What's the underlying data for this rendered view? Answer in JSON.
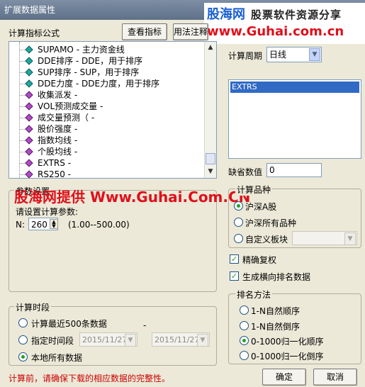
{
  "window": {
    "title": "扩展数据属性"
  },
  "brand": {
    "name": "股海网",
    "slogan": "股票软件资源分享",
    "url": "www.Guhai.com.cn"
  },
  "formula": {
    "label": "计算指标公式",
    "view_button": "查看指标",
    "usage_button": "用法注释",
    "items": [
      {
        "text": "SUPAMO - 主力资金线",
        "color": "teal"
      },
      {
        "text": "DDE排序 - DDE，用于排序",
        "color": "teal"
      },
      {
        "text": "SUP排序 - SUP，用于排序",
        "color": "teal"
      },
      {
        "text": "DDE力度 - DDE力度，用于排序",
        "color": "teal"
      },
      {
        "text": "收集派发 -",
        "color": "purple"
      },
      {
        "text": "VOL预测成交量 -",
        "color": "purple"
      },
      {
        "text": "成交量预测（ -",
        "color": "purple"
      },
      {
        "text": "股价强度 -",
        "color": "purple"
      },
      {
        "text": "指数均线 -",
        "color": "purple"
      },
      {
        "text": "个股均线 -",
        "color": "purple"
      },
      {
        "text": "EXTRS -",
        "color": "purple"
      },
      {
        "text": "RS250 -",
        "color": "purple"
      }
    ]
  },
  "params": {
    "group_title": "参数设置",
    "prompt": "请设置计算参数:",
    "n_label": "N:",
    "n_value": "260",
    "n_range": "(1.00--500.00)"
  },
  "watermark": "股海网提供 Www.Guhai.Com.CN",
  "period": {
    "label": "计算周期",
    "value": "日线"
  },
  "result_list": {
    "selected": "EXTRS"
  },
  "default_value": {
    "label": "缺省数值",
    "value": "0"
  },
  "variety": {
    "group_title": "计算品种",
    "options": [
      "沪深A股",
      "沪深所有品种",
      "自定义板块"
    ],
    "selected_index": 0
  },
  "checks": {
    "exact_rights": "精确复权",
    "rank_data": "生成横向排名数据"
  },
  "rank_method": {
    "group_title": "排名方法",
    "options": [
      "1-N自然顺序",
      "1-N自然倒序",
      "0-1000归一化顺序",
      "0-1000归一化倒序"
    ],
    "selected_index": 2
  },
  "time_range": {
    "group_title": "计算时段",
    "opt_recent": "计算最近500条数据",
    "opt_range": "指定时间段",
    "opt_all": "本地所有数据",
    "date_from": "2015/11/27",
    "date_to": "2015/11/27",
    "dash": "-"
  },
  "footer": {
    "warning": "计算前，请确保下载的相应数据的完整性。",
    "ok": "确定",
    "cancel": "取消"
  },
  "colors": {
    "accent_blue": "#316ac5",
    "warn_red": "#cc0000",
    "brand_red": "#e0101b"
  }
}
